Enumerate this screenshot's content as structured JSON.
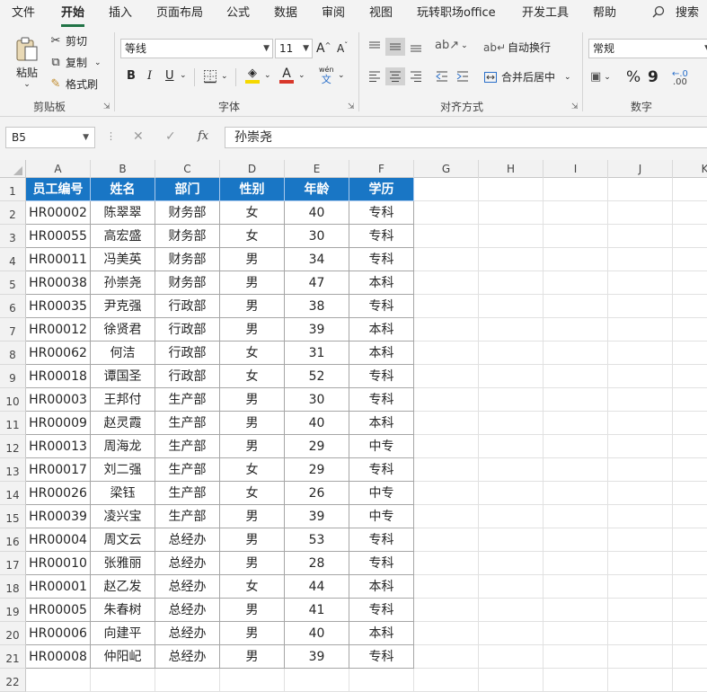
{
  "tabs": [
    {
      "label": "文件",
      "active": false
    },
    {
      "label": "开始",
      "active": true
    },
    {
      "label": "插入",
      "active": false
    },
    {
      "label": "页面布局",
      "active": false
    },
    {
      "label": "公式",
      "active": false
    },
    {
      "label": "数据",
      "active": false
    },
    {
      "label": "审阅",
      "active": false
    },
    {
      "label": "视图",
      "active": false
    },
    {
      "label": "玩转职场office",
      "active": false
    },
    {
      "label": "开发工具",
      "active": false
    },
    {
      "label": "帮助",
      "active": false
    }
  ],
  "search_label": "搜索",
  "ribbon": {
    "clipboard": {
      "paste": "粘贴",
      "cut": "剪切",
      "copy": "复制",
      "format_painter": "格式刷",
      "title": "剪贴板"
    },
    "font": {
      "name": "等线",
      "size": "11",
      "bold": "B",
      "italic": "I",
      "underline": "U",
      "grow": "A",
      "shrink": "A",
      "color_letter": "A",
      "phonetic": "wén",
      "phonetic_char": "文",
      "title": "字体"
    },
    "alignment": {
      "wrap_text": "自动换行",
      "merge_center": "合并后居中",
      "title": "对齐方式"
    },
    "number": {
      "format": "常规",
      "percent": "%",
      "comma": "9",
      "title": "数字"
    }
  },
  "formula_bar": {
    "name_box": "B5",
    "fx": "fx",
    "value": "孙崇尧"
  },
  "columns": [
    "A",
    "B",
    "C",
    "D",
    "E",
    "F",
    "G",
    "H",
    "I",
    "J",
    "K"
  ],
  "rows": [
    "1",
    "2",
    "3",
    "4",
    "5",
    "6",
    "7",
    "8",
    "9",
    "10",
    "11",
    "12",
    "13",
    "14",
    "15",
    "16",
    "17",
    "18",
    "19",
    "20",
    "21",
    "22"
  ],
  "table_header": [
    "员工编号",
    "姓名",
    "部门",
    "性别",
    "年龄",
    "学历"
  ],
  "table_rows": [
    [
      "HR00002",
      "陈翠翠",
      "财务部",
      "女",
      "40",
      "专科"
    ],
    [
      "HR00055",
      "高宏盛",
      "财务部",
      "女",
      "30",
      "专科"
    ],
    [
      "HR00011",
      "冯美英",
      "财务部",
      "男",
      "34",
      "专科"
    ],
    [
      "HR00038",
      "孙崇尧",
      "财务部",
      "男",
      "47",
      "本科"
    ],
    [
      "HR00035",
      "尹克强",
      "行政部",
      "男",
      "38",
      "专科"
    ],
    [
      "HR00012",
      "徐贤君",
      "行政部",
      "男",
      "39",
      "本科"
    ],
    [
      "HR00062",
      "何洁",
      "行政部",
      "女",
      "31",
      "本科"
    ],
    [
      "HR00018",
      "谭国圣",
      "行政部",
      "女",
      "52",
      "专科"
    ],
    [
      "HR00003",
      "王邦付",
      "生产部",
      "男",
      "30",
      "专科"
    ],
    [
      "HR00009",
      "赵灵霞",
      "生产部",
      "男",
      "40",
      "本科"
    ],
    [
      "HR00013",
      "周海龙",
      "生产部",
      "男",
      "29",
      "中专"
    ],
    [
      "HR00017",
      "刘二强",
      "生产部",
      "女",
      "29",
      "专科"
    ],
    [
      "HR00026",
      "梁钰",
      "生产部",
      "女",
      "26",
      "中专"
    ],
    [
      "HR00039",
      "凌兴宝",
      "生产部",
      "男",
      "39",
      "中专"
    ],
    [
      "HR00004",
      "周文云",
      "总经办",
      "男",
      "53",
      "专科"
    ],
    [
      "HR00010",
      "张雅丽",
      "总经办",
      "男",
      "28",
      "专科"
    ],
    [
      "HR00001",
      "赵乙发",
      "总经办",
      "女",
      "44",
      "本科"
    ],
    [
      "HR00005",
      "朱春树",
      "总经办",
      "男",
      "41",
      "专科"
    ],
    [
      "HR00006",
      "向建平",
      "总经办",
      "男",
      "40",
      "本科"
    ],
    [
      "HR00008",
      "仲阳屺",
      "总经办",
      "男",
      "39",
      "专科"
    ]
  ],
  "colors": {
    "accent": "#217346",
    "header_fill": "#1976c5",
    "font_color_bar": "#d8372a",
    "fill_color_bar": "#f5d800"
  }
}
